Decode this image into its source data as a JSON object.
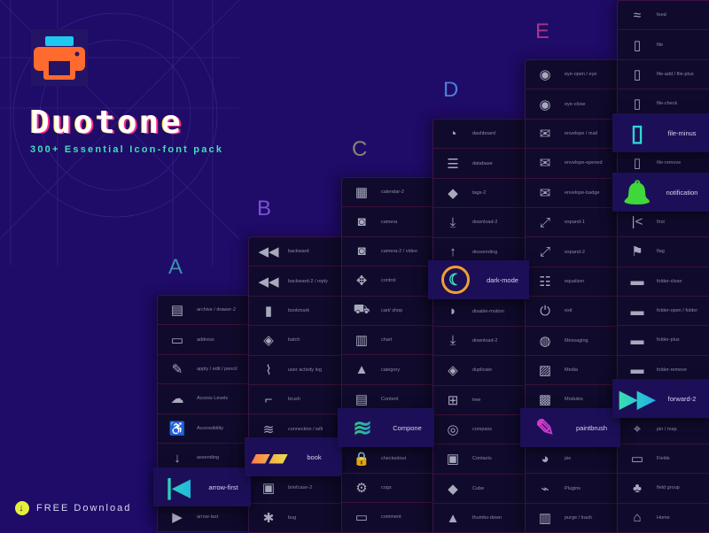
{
  "brand": {
    "title": "Duotone",
    "subtitle": "300+ Essential Icon-font pack",
    "logo_icon": "printer-icon",
    "colors": {
      "printer_body": "#ff6a2e",
      "printer_paper": "#1ec8f0",
      "background": "#1f0b68"
    }
  },
  "download": {
    "label": "FREE Download",
    "icon": "download-icon",
    "color": "#e5f03a"
  },
  "letters": [
    {
      "text": "A",
      "color": "#3b8fb0"
    },
    {
      "text": "B",
      "color": "#7b52d6"
    },
    {
      "text": "C",
      "color": "#8a8476"
    },
    {
      "text": "D",
      "color": "#4c7fd6"
    },
    {
      "text": "E",
      "color": "#a53683"
    }
  ],
  "columns": [
    {
      "id": "a",
      "rows": [
        "archive / drawer-2",
        "address",
        "apply / edit / pencil",
        "Access Levels",
        "Accessibility",
        "assending",
        "",
        "arrow-last"
      ]
    },
    {
      "id": "b",
      "rows": [
        "backward",
        "backward-2 / reply",
        "bookmark",
        "batch",
        "user activity log",
        "brush",
        "connection / wifi",
        "",
        "briefcase-2",
        "bug"
      ]
    },
    {
      "id": "c",
      "rows": [
        "calendar-2",
        "camera",
        "camera-2 / video",
        "control",
        "cart/ shop",
        "chart",
        "category",
        "Content",
        "",
        "checkedout",
        "cogs",
        "comment"
      ]
    },
    {
      "id": "d",
      "rows": [
        "dashboard",
        "database",
        "tags-2",
        "download-2",
        "dessending",
        "",
        "disable-motion",
        "download-2",
        "duplicate",
        "tree",
        "compass",
        "Contacts",
        "Cube",
        "thumbs-down"
      ]
    },
    {
      "id": "e",
      "rows": [
        "eye-open / eye",
        "eye-close",
        "envelope / mail",
        "envelope-opened",
        "envelope-badge",
        "expand-1",
        "expand-2",
        "equalizer",
        "exit",
        "Messaging",
        "Media",
        "Modules",
        "",
        "pie",
        "Plugins",
        "purge / trash"
      ]
    },
    {
      "id": "f",
      "rows": [
        "feed",
        "file",
        "file-add / file-plus",
        "file-check",
        "",
        "file-remove",
        "",
        "first",
        "flag",
        "folder-close",
        "folder-open / folder",
        "folder-plus",
        "folder-remove",
        "",
        "pin / map",
        "Fields",
        "field group",
        "Home"
      ]
    }
  ],
  "featured": [
    {
      "label": "arrow-first",
      "icon": "arrow-first-icon",
      "colors": [
        "#2ee6a8",
        "#1ea8f0"
      ]
    },
    {
      "label": "book",
      "icon": "book-icon",
      "colors": [
        "#ff6a4a",
        "#e8f04a"
      ]
    },
    {
      "label": "Compone",
      "icon": "layers-icon",
      "colors": [
        "#3ef04a",
        "#1e7af0"
      ]
    },
    {
      "label": "dark-mode",
      "icon": "moon-icon",
      "colors": [
        "#f0a030",
        "#3ee6b0"
      ]
    },
    {
      "label": "paintbrush",
      "icon": "paintbrush-icon",
      "colors": [
        "#ff3aa0",
        "#9a3af0"
      ]
    },
    {
      "label": "file-minus",
      "icon": "file-minus-icon",
      "colors": [
        "#1ec8f0",
        "#3ee6b0"
      ]
    },
    {
      "label": "notification",
      "icon": "bell-icon",
      "colors": [
        "#3ed83a",
        "#3ed83a"
      ]
    },
    {
      "label": "forward-2",
      "icon": "forward-icon",
      "colors": [
        "#3ee6a8",
        "#1ea8f0"
      ]
    }
  ]
}
